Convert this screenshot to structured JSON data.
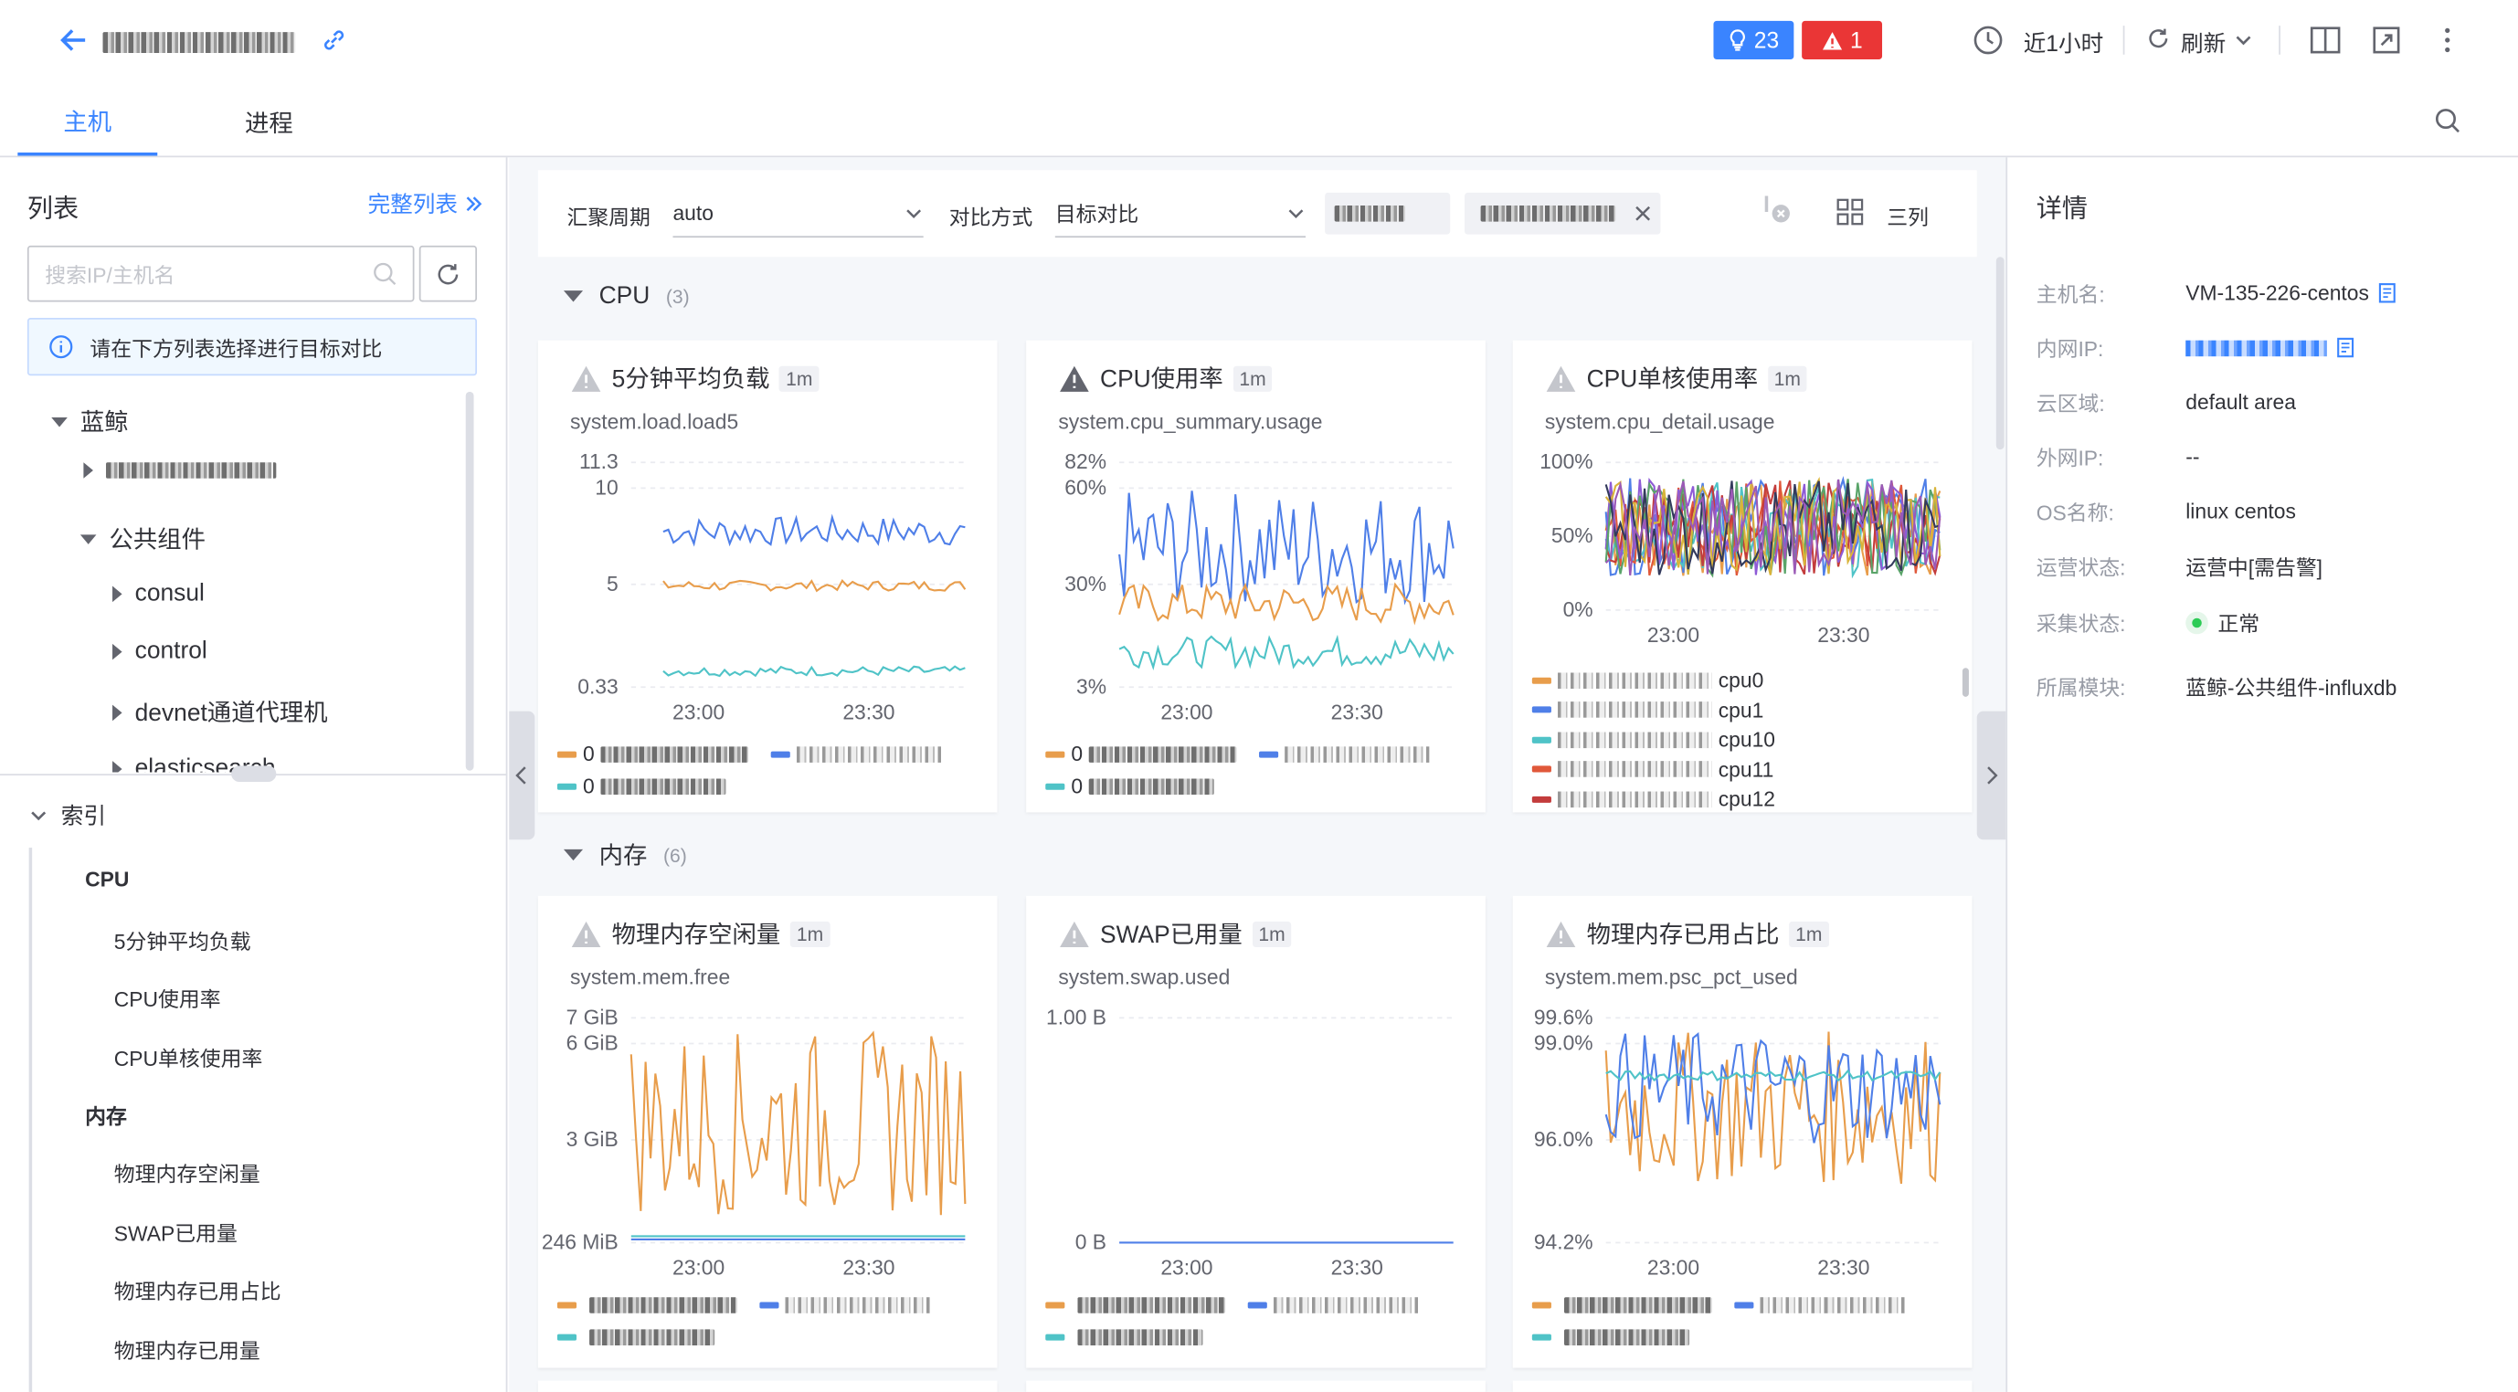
{
  "header": {
    "insight_count": "23",
    "alert_count": "1",
    "time_range": "近1小时",
    "refresh_label": "刷新",
    "tabs": [
      {
        "label": "主机"
      },
      {
        "label": "进程"
      }
    ]
  },
  "left": {
    "title": "列表",
    "full_list_link": "完整列表",
    "search_placeholder": "搜索IP/主机名",
    "info_text": "请在下方列表选择进行目标对比",
    "tree": {
      "root": "蓝鲸",
      "group": "公共组件",
      "children": [
        "consul",
        "control",
        "devnet通道代理机",
        "elasticsearch"
      ]
    },
    "index": {
      "title": "索引",
      "sections": [
        {
          "name": "CPU",
          "items": [
            "5分钟平均负载",
            "CPU使用率",
            "CPU单核使用率"
          ]
        },
        {
          "name": "内存",
          "items": [
            "物理内存空闲量",
            "SWAP已用量",
            "物理内存已用占比",
            "物理内存已用量"
          ]
        }
      ]
    }
  },
  "toolbar": {
    "period_label": "汇聚周期",
    "period_value": "auto",
    "compare_label": "对比方式",
    "compare_value": "目标对比",
    "columns_label": "三列"
  },
  "sections": [
    {
      "name": "CPU",
      "count": "(3)",
      "cards": [
        {
          "title": "5分钟平均负载",
          "interval": "1m",
          "metric": "system.load.load5",
          "y_ticks": [
            "11.3",
            "10",
            "5",
            "0.33"
          ],
          "x_ticks": [
            "23:00",
            "23:30"
          ],
          "legend": [
            "0",
            "0"
          ]
        },
        {
          "title": "CPU使用率",
          "interval": "1m",
          "metric": "system.cpu_summary.usage",
          "y_ticks": [
            "82%",
            "60%",
            "30%",
            "3%"
          ],
          "x_ticks": [
            "23:00",
            "23:30"
          ],
          "legend": [
            "0",
            "0"
          ]
        },
        {
          "title": "CPU单核使用率",
          "interval": "1m",
          "metric": "system.cpu_detail.usage",
          "y_ticks": [
            "100%",
            "50%",
            "0%"
          ],
          "x_ticks": [
            "23:00",
            "23:30"
          ],
          "legend": [
            "cpu0",
            "cpu1",
            "cpu10",
            "cpu11",
            "cpu12"
          ]
        }
      ]
    },
    {
      "name": "内存",
      "count": "(6)",
      "cards": [
        {
          "title": "物理内存空闲量",
          "interval": "1m",
          "metric": "system.mem.free",
          "y_ticks": [
            "7 GiB",
            "6 GiB",
            "3 GiB",
            "246 MiB"
          ],
          "x_ticks": [
            "23:00",
            "23:30"
          ],
          "legend": [
            "",
            ""
          ]
        },
        {
          "title": "SWAP已用量",
          "interval": "1m",
          "metric": "system.swap.used",
          "y_ticks": [
            "1.00 B",
            "0 B"
          ],
          "x_ticks": [
            "23:00",
            "23:30"
          ],
          "legend": [
            "",
            ""
          ]
        },
        {
          "title": "物理内存已用占比",
          "interval": "1m",
          "metric": "system.mem.psc_pct_used",
          "y_ticks": [
            "99.6%",
            "99.0%",
            "96.0%",
            "94.2%"
          ],
          "x_ticks": [
            "23:00",
            "23:30"
          ],
          "legend": [
            "",
            ""
          ]
        }
      ]
    }
  ],
  "details": {
    "title": "详情",
    "rows": [
      {
        "k": "主机名:",
        "v": "VM-135-226-centos"
      },
      {
        "k": "内网IP:",
        "v": ""
      },
      {
        "k": "云区域:",
        "v": "default area"
      },
      {
        "k": "外网IP:",
        "v": "--"
      },
      {
        "k": "OS名称:",
        "v": "linux centos"
      },
      {
        "k": "运营状态:",
        "v": "运营中[需告警]"
      },
      {
        "k": "采集状态:",
        "v": "正常"
      },
      {
        "k": "所属模块:",
        "v": "蓝鲸-公共组件-influxdb"
      }
    ]
  },
  "colors": {
    "accent": "#3a84ff",
    "alert": "#ea3636",
    "orange": "#e89d4b",
    "blue": "#4f7fe8",
    "teal": "#4fc3c7",
    "ok": "#2dcb56"
  }
}
